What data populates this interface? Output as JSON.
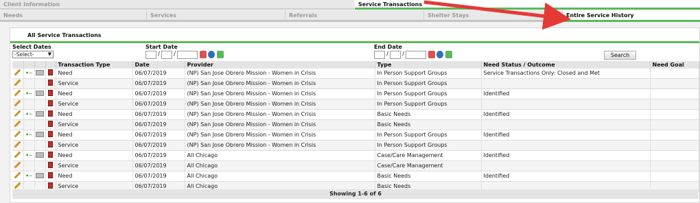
{
  "tabs_top": [
    "Client Information",
    "Service Transactions"
  ],
  "tabs_sub": [
    "Needs",
    "Services",
    "Referrals",
    "Shelter Stays",
    "Entire Service History"
  ],
  "panel_title": "All Service Transactions",
  "filters": {
    "select_dates_label": "Select Dates",
    "select_value": "-Select-",
    "start_date_label": "Start Date",
    "end_date_label": "End Date",
    "search_label": "Search"
  },
  "columns": [
    "Transaction Type",
    "Date",
    "Provider",
    "Type",
    "Need Status / Outcome",
    "Need Goal"
  ],
  "rows": [
    {
      "ttype": "Need",
      "date": "06/07/2019",
      "provider": "(NP) San Jose Obrero Mission - Women in Crisis",
      "type": "In Person Support Groups",
      "status": "Service Transactions Only: Closed and Met",
      "goal": ""
    },
    {
      "ttype": "Service",
      "date": "06/07/2019",
      "provider": "(NP) San Jose Obrero Mission - Women in Crisis",
      "type": "In Person Support Groups",
      "status": "",
      "goal": ""
    },
    {
      "ttype": "Need",
      "date": "06/07/2019",
      "provider": "(NP) San Jose Obrero Mission - Women in Crisis",
      "type": "In Person Support Groups",
      "status": "Identified",
      "goal": ""
    },
    {
      "ttype": "Service",
      "date": "06/07/2019",
      "provider": "(NP) San Jose Obrero Mission - Women in Crisis",
      "type": "In Person Support Groups",
      "status": "",
      "goal": ""
    },
    {
      "ttype": "Need",
      "date": "06/07/2019",
      "provider": "(NP) San Jose Obrero Mission - Women in Crisis",
      "type": "Basic Needs",
      "status": "Identified",
      "goal": ""
    },
    {
      "ttype": "Service",
      "date": "06/07/2019",
      "provider": "(NP) San Jose Obrero Mission - Women in Crisis",
      "type": "Basic Needs",
      "status": "",
      "goal": ""
    },
    {
      "ttype": "Need",
      "date": "06/07/2019",
      "provider": "(NP) San Jose Obrero Mission - Women in Crisis",
      "type": "In Person Support Groups",
      "status": "Identified",
      "goal": ""
    },
    {
      "ttype": "Service",
      "date": "06/07/2019",
      "provider": "(NP) San Jose Obrero Mission - Women in Crisis",
      "type": "In Person Support Groups",
      "status": "",
      "goal": ""
    },
    {
      "ttype": "Need",
      "date": "06/07/2019",
      "provider": "All Chicago",
      "type": "Case/Care Management",
      "status": "Identified",
      "goal": ""
    },
    {
      "ttype": "Service",
      "date": "06/07/2019",
      "provider": "All Chicago",
      "type": "Case/Care Management",
      "status": "",
      "goal": ""
    },
    {
      "ttype": "Need",
      "date": "06/07/2019",
      "provider": "All Chicago",
      "type": "Basic Needs",
      "status": "Identified",
      "goal": ""
    },
    {
      "ttype": "Service",
      "date": "06/07/2019",
      "provider": "All Chicago",
      "type": "Basic Needs",
      "status": "",
      "goal": ""
    }
  ],
  "footer": "Showing 1-6 of 6",
  "icons": {
    "edit": "pencil-icon",
    "link": "connect-icon",
    "folder": "container-icon",
    "delete": "trash-icon"
  },
  "accent_color": "#5cb85c",
  "annotation_color": "#e53935"
}
